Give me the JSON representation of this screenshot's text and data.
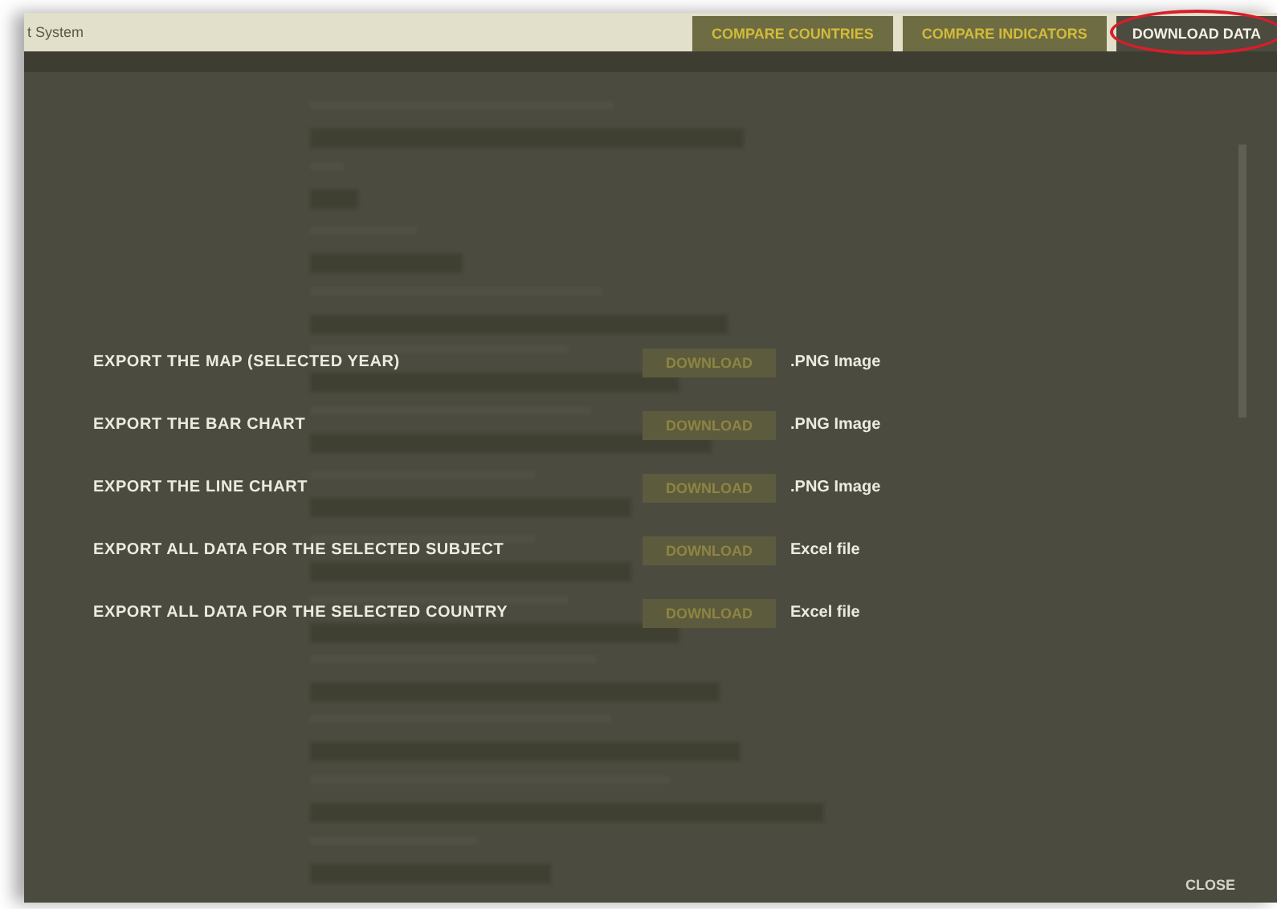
{
  "header": {
    "title": "t System"
  },
  "tabs": [
    {
      "label": "COMPARE COUNTRIES",
      "selected": false
    },
    {
      "label": "COMPARE INDICATORS",
      "selected": false
    },
    {
      "label": "DOWNLOAD DATA",
      "selected": true
    }
  ],
  "exports": [
    {
      "label": "EXPORT THE MAP (SELECTED YEAR)",
      "button": "DOWNLOAD",
      "format": ".PNG Image"
    },
    {
      "label": "EXPORT THE BAR CHART",
      "button": "DOWNLOAD",
      "format": ".PNG Image"
    },
    {
      "label": "EXPORT THE LINE CHART",
      "button": "DOWNLOAD",
      "format": ".PNG Image"
    },
    {
      "label": "EXPORT ALL DATA FOR THE SELECTED SUBJECT",
      "button": "DOWNLOAD",
      "format": "Excel file"
    },
    {
      "label": "EXPORT ALL DATA FOR THE SELECTED COUNTRY",
      "button": "DOWNLOAD",
      "format": "Excel file"
    }
  ],
  "close": "CLOSE"
}
